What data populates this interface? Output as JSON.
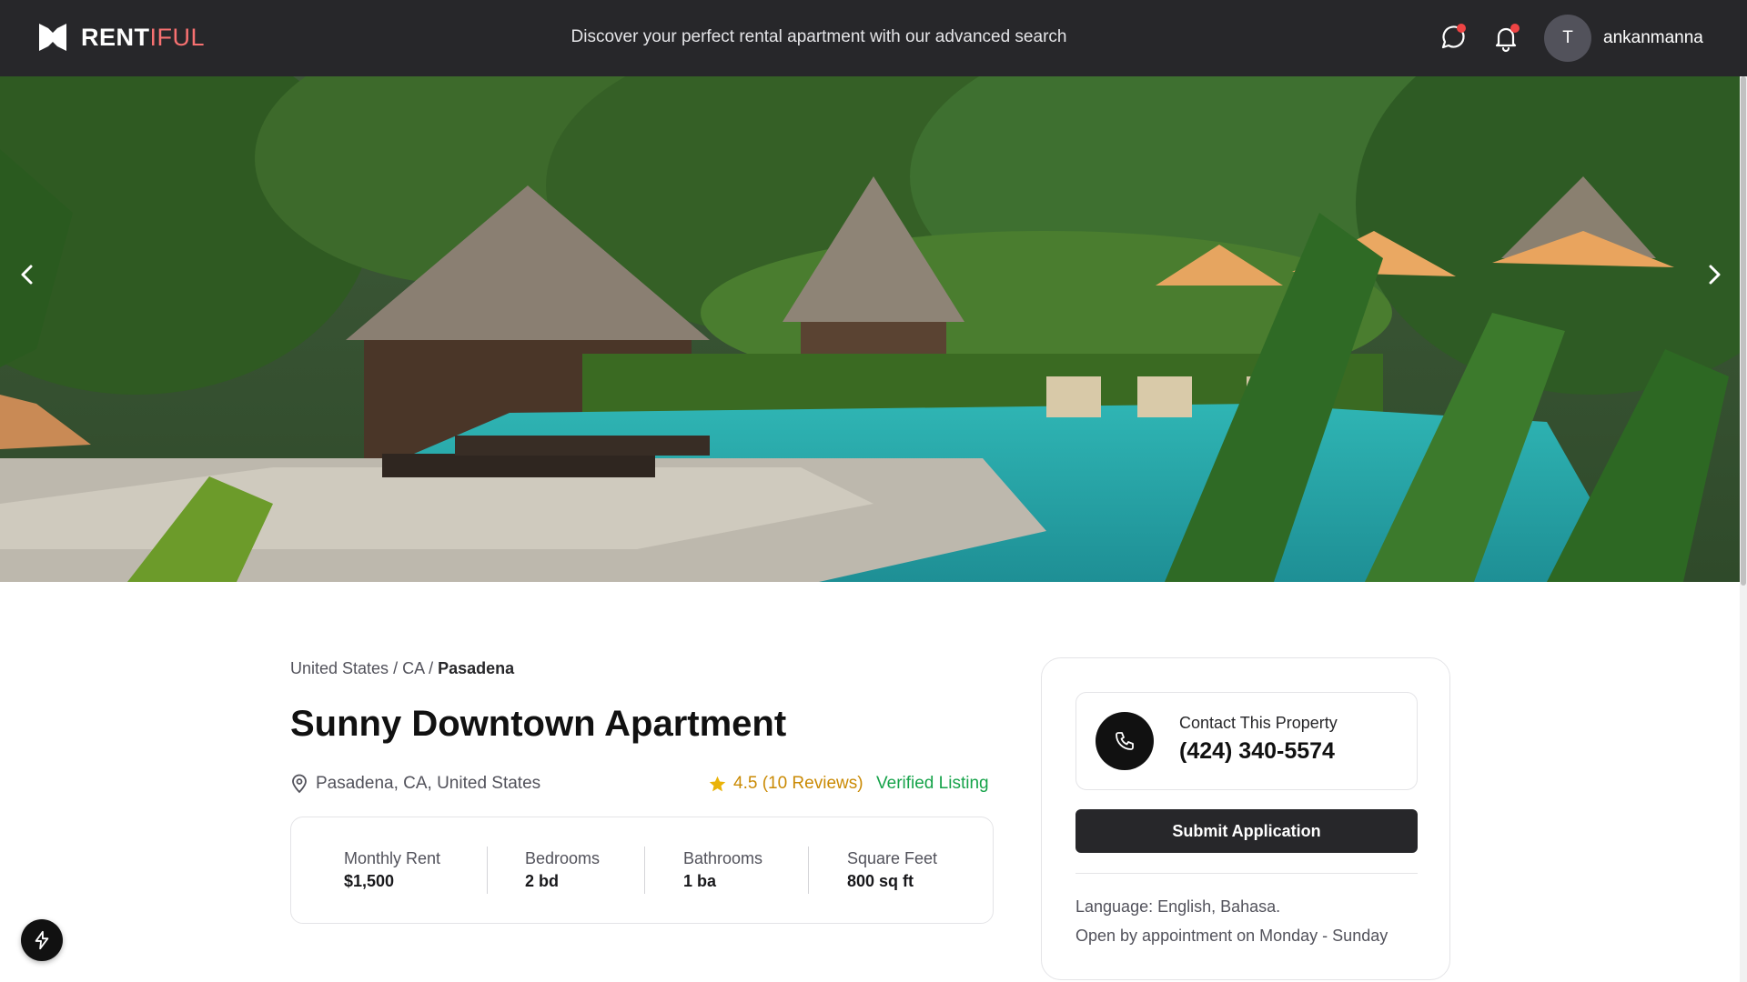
{
  "header": {
    "brand_bold": "RENT",
    "brand_light": "IFUL",
    "tagline": "Discover your perfect rental apartment with our advanced search",
    "icons": [
      "message-icon",
      "bell-icon"
    ],
    "user": {
      "avatar_initial": "T",
      "username": "ankanmanna"
    }
  },
  "hero": {
    "prev_icon": "chevron-left-icon",
    "next_icon": "chevron-right-icon"
  },
  "property": {
    "breadcrumb": {
      "country": "United States",
      "sep1": " / ",
      "state": "CA",
      "sep2": " / ",
      "city": "Pasadena"
    },
    "title": "Sunny Downtown Apartment",
    "location": "Pasadena, CA, United States",
    "rating": "4.5 (10 Reviews)",
    "verified": "Verified Listing",
    "stats": [
      {
        "label": "Monthly Rent",
        "value": "$1,500"
      },
      {
        "label": "Bedrooms",
        "value": "2 bd"
      },
      {
        "label": "Bathrooms",
        "value": "1 ba"
      },
      {
        "label": "Square Feet",
        "value": "800 sq ft"
      }
    ]
  },
  "contact": {
    "label": "Contact This Property",
    "phone": "(424) 340-5574",
    "submit_label": "Submit Application",
    "language": "Language: English, Bahasa.",
    "hours": "Open by appointment on Monday - Sunday"
  },
  "colors": {
    "navbar": "#27272a",
    "accent_red": "#f87171",
    "rating_gold": "#ca8a04",
    "verified_green": "#16a34a"
  }
}
